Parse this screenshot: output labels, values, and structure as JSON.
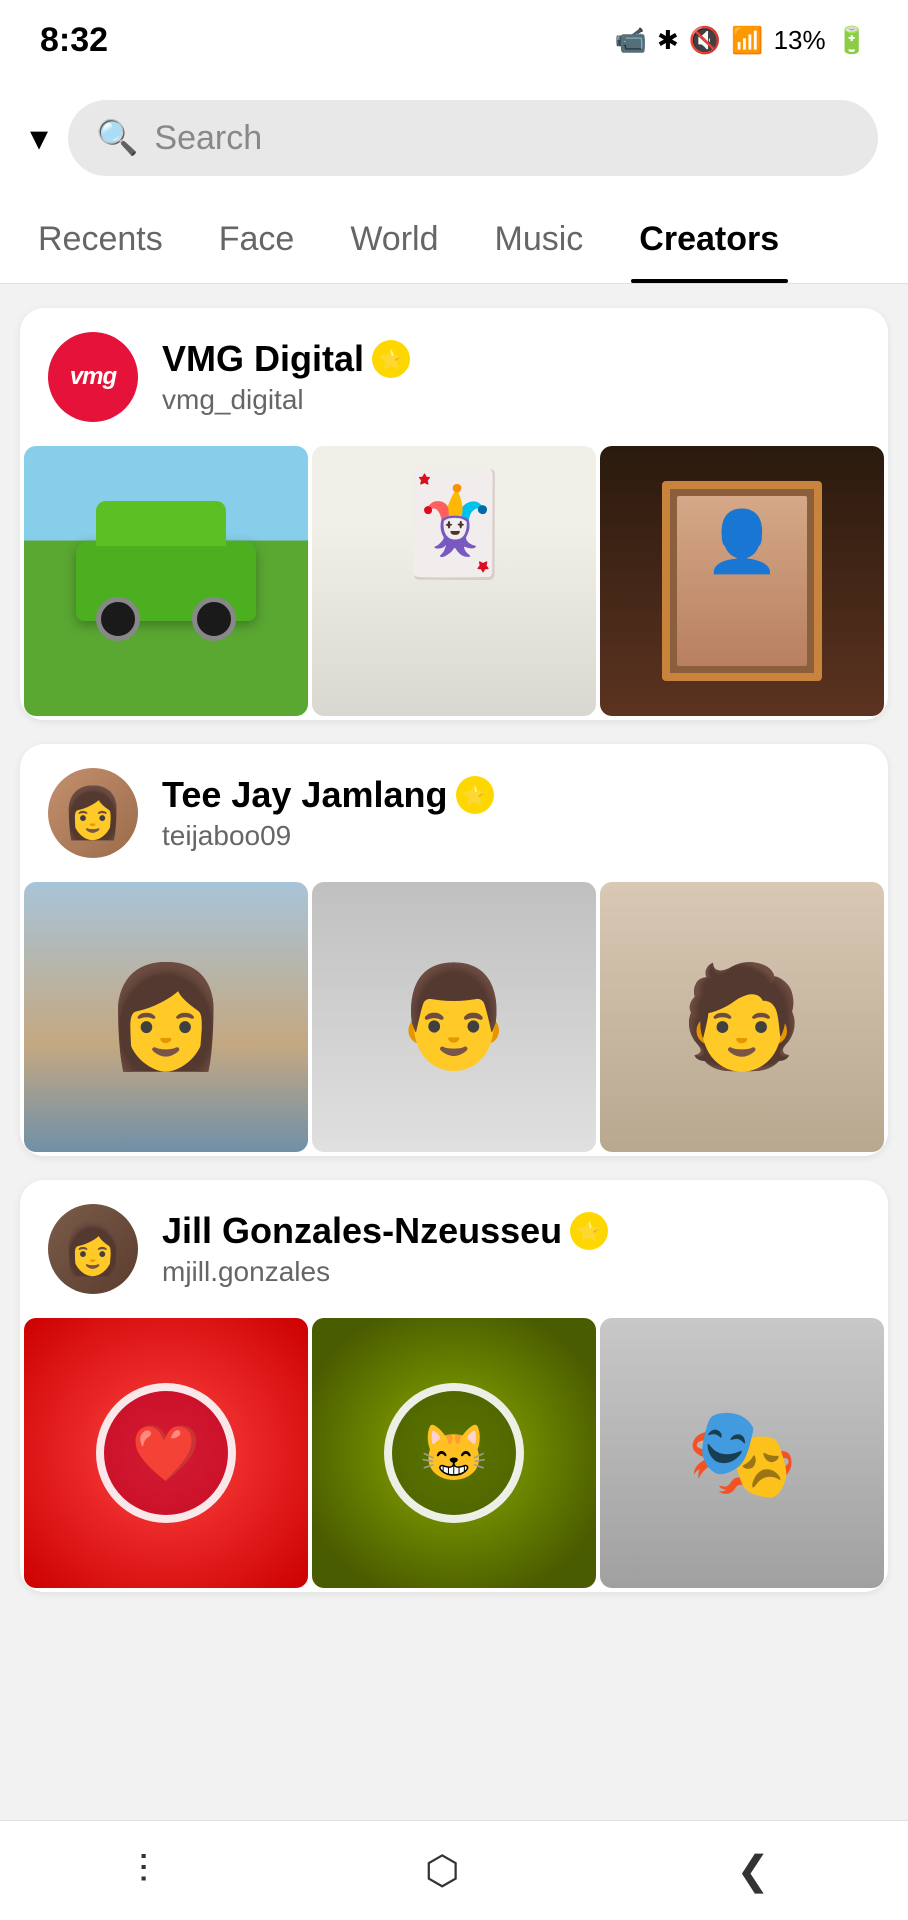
{
  "status_bar": {
    "time": "8:32",
    "camera_icon": "📹",
    "battery": "13%",
    "signal": "📶"
  },
  "search": {
    "placeholder": "Search",
    "dropdown_label": "dropdown",
    "icon": "🔍"
  },
  "tabs": [
    {
      "id": "recents",
      "label": "Recents",
      "active": false
    },
    {
      "id": "face",
      "label": "Face",
      "active": false
    },
    {
      "id": "world",
      "label": "World",
      "active": false
    },
    {
      "id": "music",
      "label": "Music",
      "active": false
    },
    {
      "id": "creators",
      "label": "Creators",
      "active": true
    }
  ],
  "creators": [
    {
      "id": "vmg-digital",
      "name": "VMG Digital",
      "username": "vmg_digital",
      "avatar_text": "vmg",
      "avatar_color": "#e5133a",
      "verified": true,
      "images": [
        {
          "id": "car",
          "type": "car"
        },
        {
          "id": "jester",
          "type": "jester"
        },
        {
          "id": "portrait",
          "type": "portrait"
        }
      ]
    },
    {
      "id": "tee-jay",
      "name": "Tee Jay Jamlang",
      "username": "teijaboo09",
      "avatar_text": "👩",
      "avatar_color": "#c4906e",
      "verified": true,
      "images": [
        {
          "id": "woman-bug",
          "type": "woman-bug"
        },
        {
          "id": "man-bug",
          "type": "man-bug"
        },
        {
          "id": "man2-bug",
          "type": "man2-bug"
        }
      ]
    },
    {
      "id": "jill-gonzales",
      "name": "Jill Gonzales-Nzeusseu",
      "username": "mjill.gonzales",
      "avatar_text": "👤",
      "avatar_color": "#7a5c4a",
      "verified": true,
      "images": [
        {
          "id": "red-badge",
          "type": "red-badge"
        },
        {
          "id": "green-badge",
          "type": "green-badge"
        },
        {
          "id": "mask",
          "type": "mask"
        }
      ]
    }
  ],
  "bottom_nav": {
    "back_icon": "❮",
    "home_icon": "⬡",
    "menu_icon": "|||"
  }
}
